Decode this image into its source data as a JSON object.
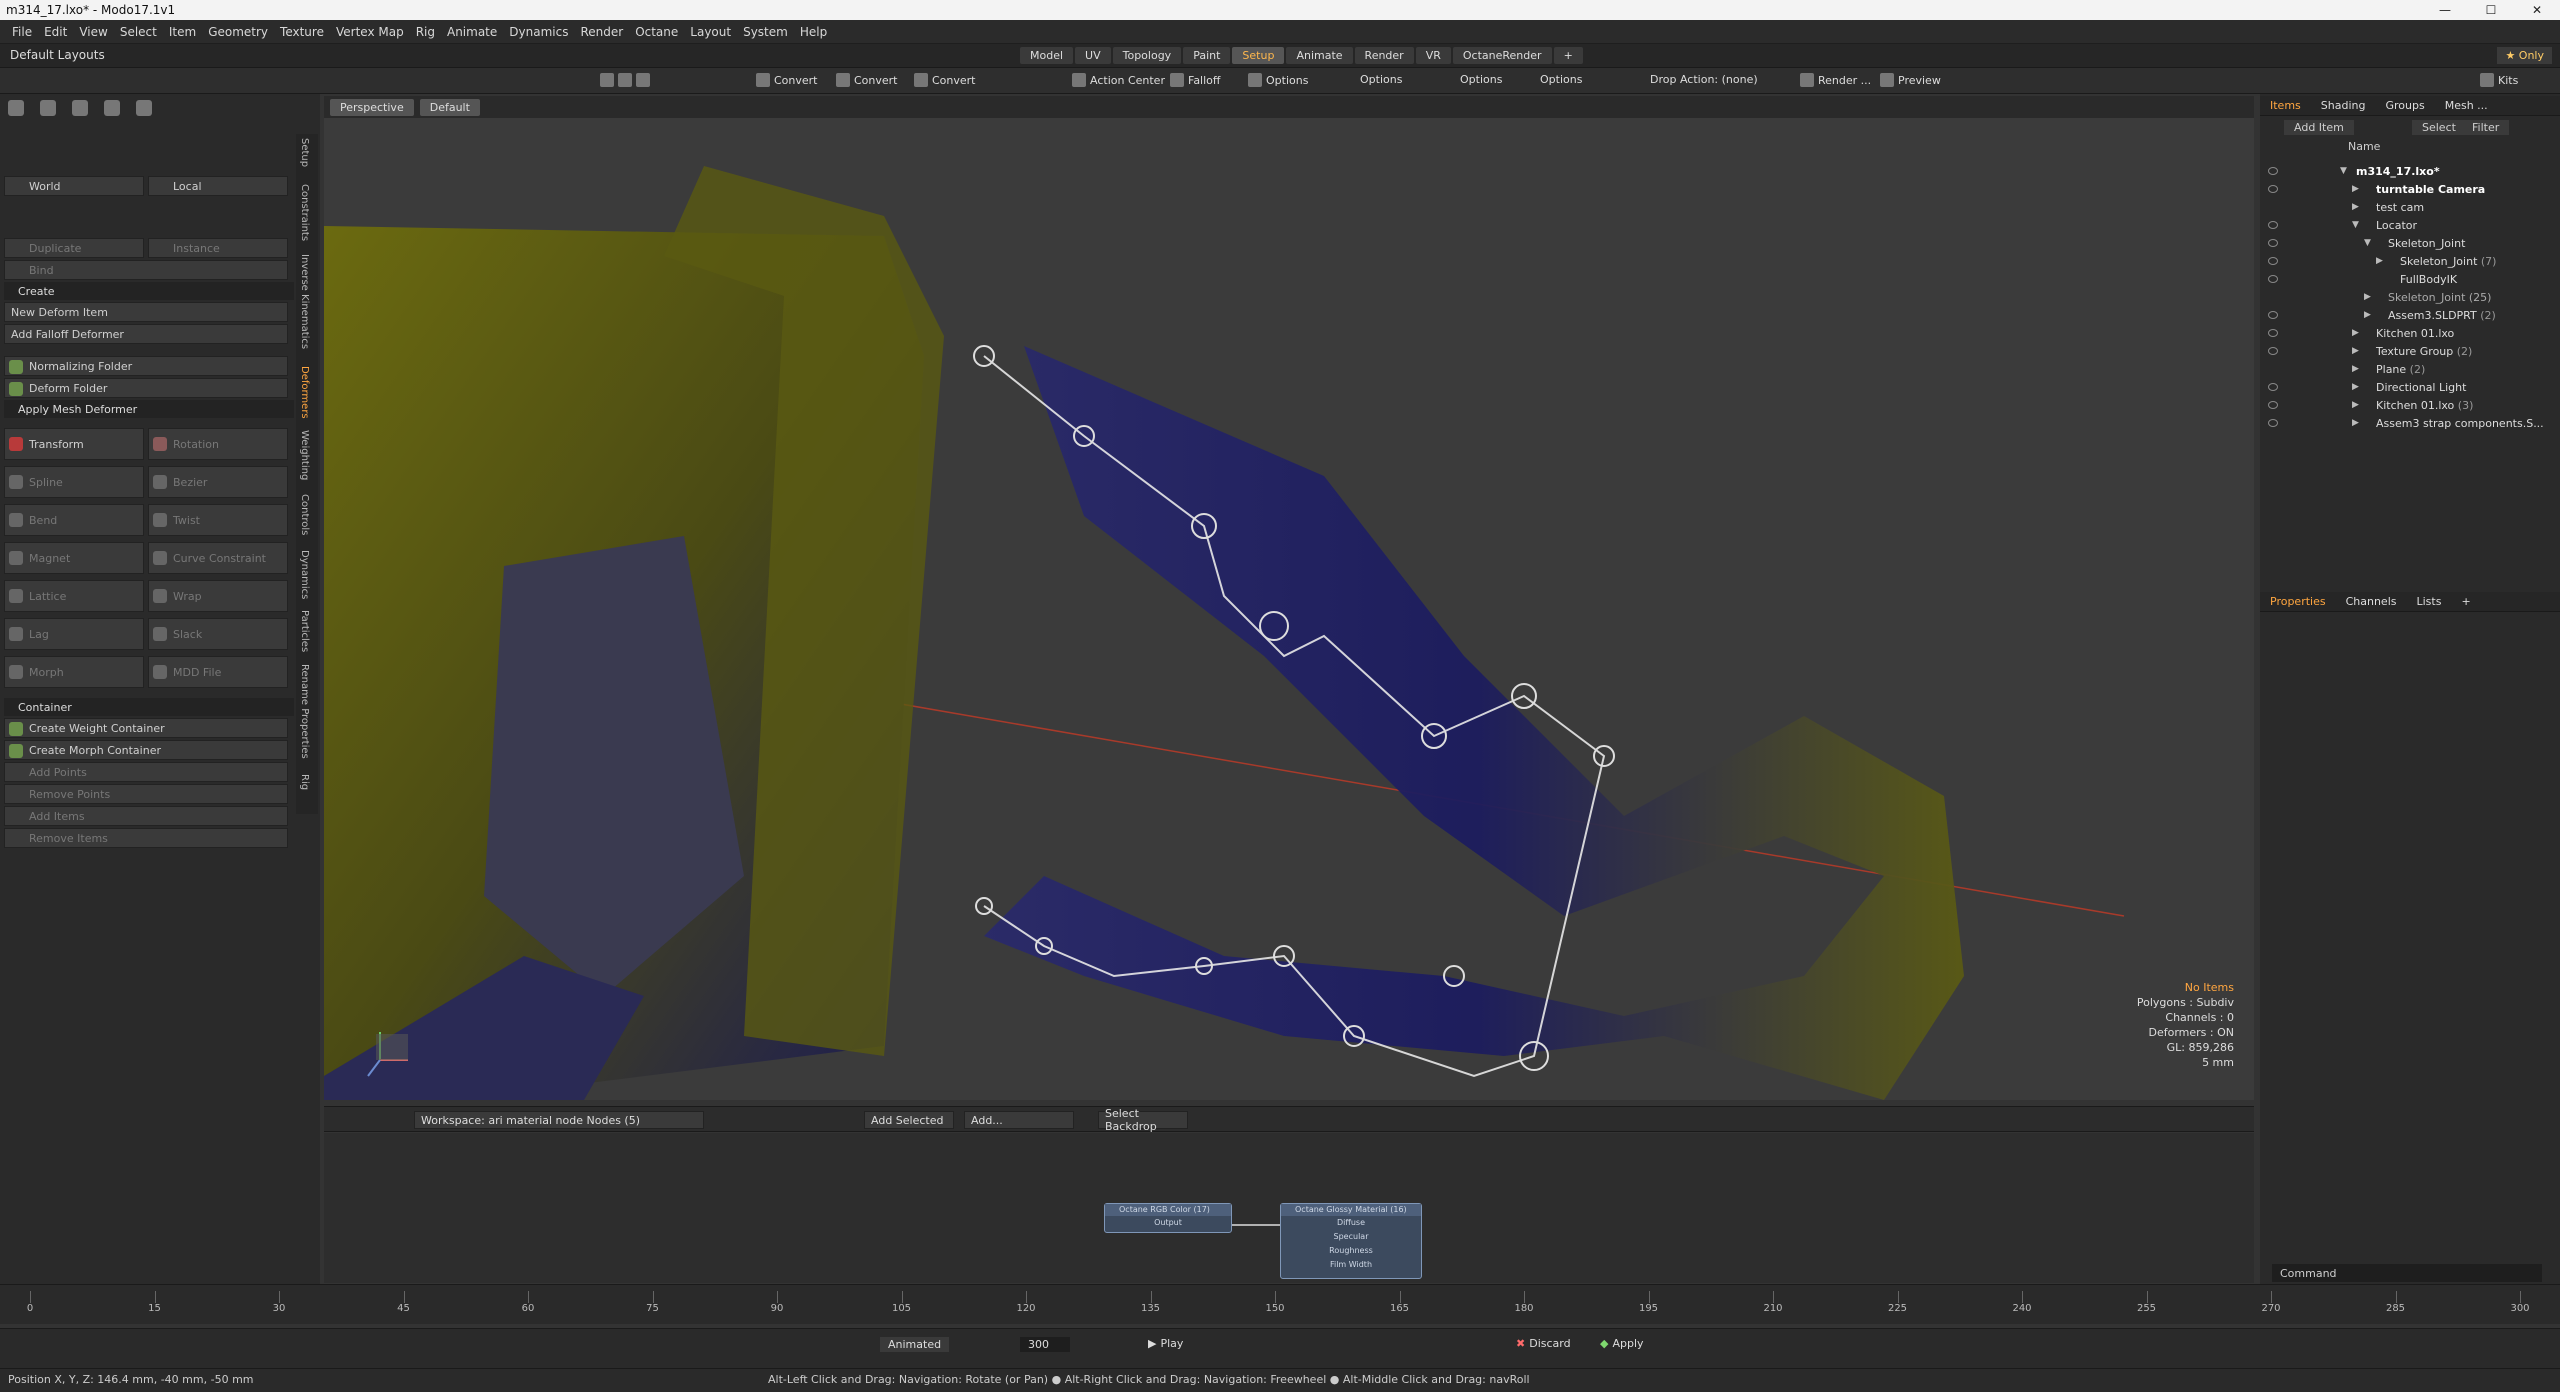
{
  "window": {
    "title": "m314_17.lxo* - Modo17.1v1",
    "controls": [
      "—",
      "☐",
      "✕"
    ]
  },
  "menu": [
    "File",
    "Edit",
    "View",
    "Select",
    "Item",
    "Geometry",
    "Texture",
    "Vertex Map",
    "Rig",
    "Animate",
    "Dynamics",
    "Render",
    "Octane",
    "Layout",
    "System",
    "Help"
  ],
  "layout": {
    "name": "Default Layouts"
  },
  "tabs": [
    {
      "label": "Model"
    },
    {
      "label": "UV"
    },
    {
      "label": "Topology"
    },
    {
      "label": "Paint"
    },
    {
      "label": "Setup",
      "active": true
    },
    {
      "label": "Animate"
    },
    {
      "label": "Render"
    },
    {
      "label": "VR"
    },
    {
      "label": "OctaneRender"
    },
    {
      "label": "+"
    }
  ],
  "top_right": {
    "only": "★ Only"
  },
  "toolbar": {
    "convert1": "Convert",
    "convert2": "Convert",
    "convert3": "Convert",
    "action_center": "Action Center",
    "falloff": "Falloff",
    "options1": "Options",
    "options2": "Options",
    "options3": "Options",
    "options4": "Options",
    "drop_action": "Drop Action: (none)",
    "render": "Render ...",
    "preview": "Preview",
    "kits": "Kits"
  },
  "left": {
    "world": "World",
    "local": "Local",
    "duplicate": "Duplicate",
    "instance": "Instance",
    "bind": "Bind",
    "create_header": "Create",
    "new_deform": "New Deform Item",
    "add_falloff": "Add Falloff Deformer",
    "normalizing": "Normalizing Folder",
    "deform_folder": "Deform Folder",
    "apply_mesh": "Apply Mesh Deformer",
    "tools": [
      [
        "Transform",
        "Rotation"
      ],
      [
        "Spline",
        "Bezier"
      ],
      [
        "Bend",
        "Twist"
      ],
      [
        "Magnet",
        "Curve Constraint"
      ],
      [
        "Lattice",
        "Wrap"
      ],
      [
        "Lag",
        "Slack"
      ],
      [
        "Morph",
        "MDD File"
      ]
    ],
    "container_header": "Container",
    "container": [
      "Create Weight Container",
      "Create Morph Container",
      "Add Points",
      "Remove Points",
      "Add Items",
      "Remove Items"
    ]
  },
  "vtabs": [
    "Setup",
    "Constraints",
    "Inverse Kinematics",
    "Deformers",
    "Weighting",
    "Controls",
    "Dynamics",
    "Particles",
    "Rename Properties",
    "Rig"
  ],
  "viewport": {
    "view": "Perspective",
    "style": "Default",
    "info": {
      "noitems": "No Items",
      "polygons": "Polygons : Subdiv",
      "channels": "Channels : 0",
      "deformers": "Deformers : ON",
      "gl": "GL: 859,286",
      "unit": "5 mm"
    }
  },
  "nodebar": {
    "workspace": "Workspace: ari material node Nodes (5)",
    "add_selected": "Add Selected",
    "add": "Add...",
    "backdrop": "Select Backdrop"
  },
  "nodes": [
    {
      "title": "Octane RGB Color (17)",
      "ports": [
        "Output"
      ]
    },
    {
      "title": "Octane Glossy Material (16)",
      "ports": [
        "Diffuse",
        "Specular",
        "Roughness",
        "Film Width"
      ]
    }
  ],
  "right": {
    "tabs": [
      "Items",
      "Shading",
      "Groups",
      "Mesh ..."
    ],
    "buttons": {
      "add_item": "Add Item",
      "select": "Select",
      "filter": "Filter"
    },
    "col_name": "Name",
    "tree": [
      {
        "label": "m314_17.lxo*",
        "bold": true
      },
      {
        "label": "turntable Camera",
        "bold": true
      },
      {
        "label": "test cam"
      },
      {
        "label": "Locator"
      },
      {
        "label": "Skeleton_Joint"
      },
      {
        "label": "Skeleton_Joint",
        "suffix": "(7)"
      },
      {
        "label": "FullBodyIK"
      },
      {
        "label": "Skeleton_Joint",
        "suffix": "(25)"
      },
      {
        "label": "Assem3.SLDPRT",
        "suffix": "(2)"
      },
      {
        "label": "Kitchen 01.lxo"
      },
      {
        "label": "Texture Group",
        "suffix": "(2)"
      },
      {
        "label": "Plane",
        "suffix": "(2)"
      },
      {
        "label": "Directional Light"
      },
      {
        "label": "Kitchen 01.lxo",
        "suffix": "(3)"
      },
      {
        "label": "Assem3 strap components.S..."
      }
    ],
    "props_tabs": [
      "Properties",
      "Channels",
      "Lists",
      "+"
    ],
    "command": "Command"
  },
  "timeline": {
    "ticks": [
      "0",
      "15",
      "30",
      "45",
      "60",
      "75",
      "90",
      "105",
      "120",
      "135",
      "150",
      "165",
      "180",
      "195",
      "210",
      "225",
      "240",
      "255",
      "270",
      "285",
      "300"
    ]
  },
  "playbar": {
    "mode": "Animated",
    "frame": "300",
    "play": "Play",
    "discard": "Discard",
    "apply": "Apply"
  },
  "status": {
    "position": "Position X, Y, Z:  146.4 mm, -40 mm, -50 mm",
    "hint": "Alt-Left Click and Drag: Navigation: Rotate (or Pan) ● Alt-Right Click and Drag: Navigation: Freewheel ● Alt-Middle Click and Drag: navRoll"
  }
}
